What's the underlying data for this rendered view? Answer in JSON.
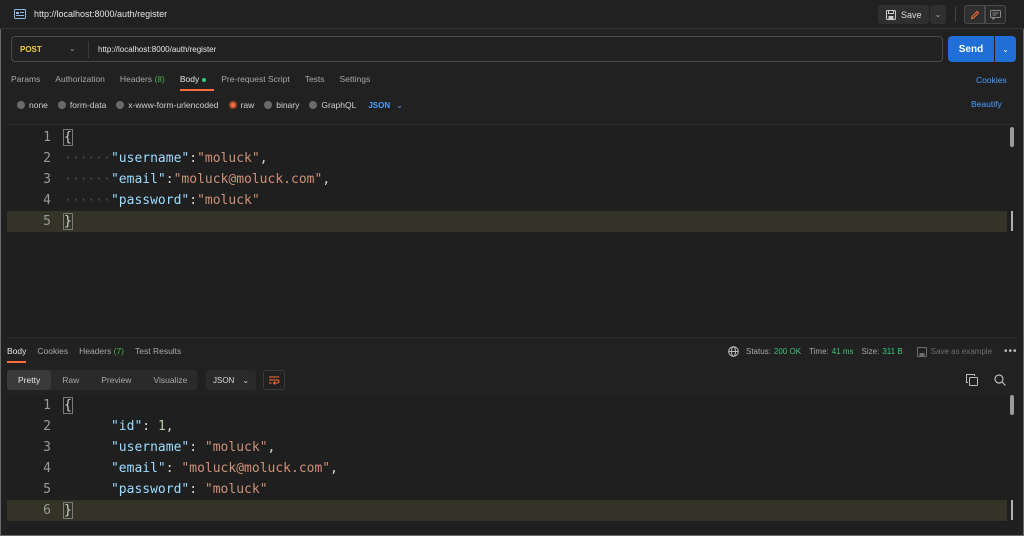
{
  "window": {
    "request_title": "http://localhost:8000/auth/register",
    "save_label": "Save"
  },
  "request": {
    "method": "POST",
    "url": "http://localhost:8000/auth/register",
    "send_label": "Send",
    "tabs": [
      {
        "label": "Params"
      },
      {
        "label": "Authorization"
      },
      {
        "label": "Headers",
        "count": "(8)"
      },
      {
        "label": "Body"
      },
      {
        "label": "Pre-request Script"
      },
      {
        "label": "Tests"
      },
      {
        "label": "Settings"
      }
    ],
    "cookies_label": "Cookies",
    "body_types": [
      "none",
      "form-data",
      "x-www-form-urlencoded",
      "raw",
      "binary",
      "GraphQL"
    ],
    "body_format": "JSON",
    "beautify_label": "Beautify",
    "lines": [
      {
        "no": "1",
        "text": "{"
      },
      {
        "no": "2",
        "key": "\"username\"",
        "sep": ":",
        "value": "\"moluck\"",
        "end": ","
      },
      {
        "no": "3",
        "key": "\"email\"",
        "sep": ":",
        "value": "\"moluck@moluck.com\"",
        "end": ","
      },
      {
        "no": "4",
        "key": "\"password\"",
        "sep": ":",
        "value": "\"moluck\"",
        "end": ""
      },
      {
        "no": "5",
        "text": "}"
      }
    ]
  },
  "response": {
    "tabs": [
      {
        "label": "Body"
      },
      {
        "label": "Cookies"
      },
      {
        "label": "Headers",
        "count": "(7)"
      },
      {
        "label": "Test Results"
      }
    ],
    "status_label": "Status:",
    "status_value": "200 OK",
    "time_label": "Time:",
    "time_value": "41 ms",
    "size_label": "Size:",
    "size_value": "311 B",
    "save_example_label": "Save as example",
    "views": [
      "Pretty",
      "Raw",
      "Preview",
      "Visualize"
    ],
    "format": "JSON",
    "lines": [
      {
        "no": "1",
        "text": "{"
      },
      {
        "no": "2",
        "key": "\"id\"",
        "sep": ": ",
        "value": "1",
        "end": ","
      },
      {
        "no": "3",
        "key": "\"username\"",
        "sep": ": ",
        "value": "\"moluck\"",
        "end": ","
      },
      {
        "no": "4",
        "key": "\"email\"",
        "sep": ": ",
        "value": "\"moluck@moluck.com\"",
        "end": ","
      },
      {
        "no": "5",
        "key": "\"password\"",
        "sep": ": ",
        "value": "\"moluck\"",
        "end": ""
      },
      {
        "no": "6",
        "text": "}"
      }
    ]
  },
  "colors": {
    "accent_orange": "#ff6c37",
    "send_blue": "#1f6fd6",
    "link_blue": "#4a9eff",
    "status_green": "#3ec47b",
    "method_yellow": "#f2c94c"
  },
  "icons": [
    "request-icon",
    "save-icon",
    "chevron-down-icon",
    "pencil-icon",
    "comment-icon",
    "globe-icon",
    "save-example-icon",
    "more-icon",
    "wrap-icon",
    "copy-icon",
    "search-icon"
  ]
}
